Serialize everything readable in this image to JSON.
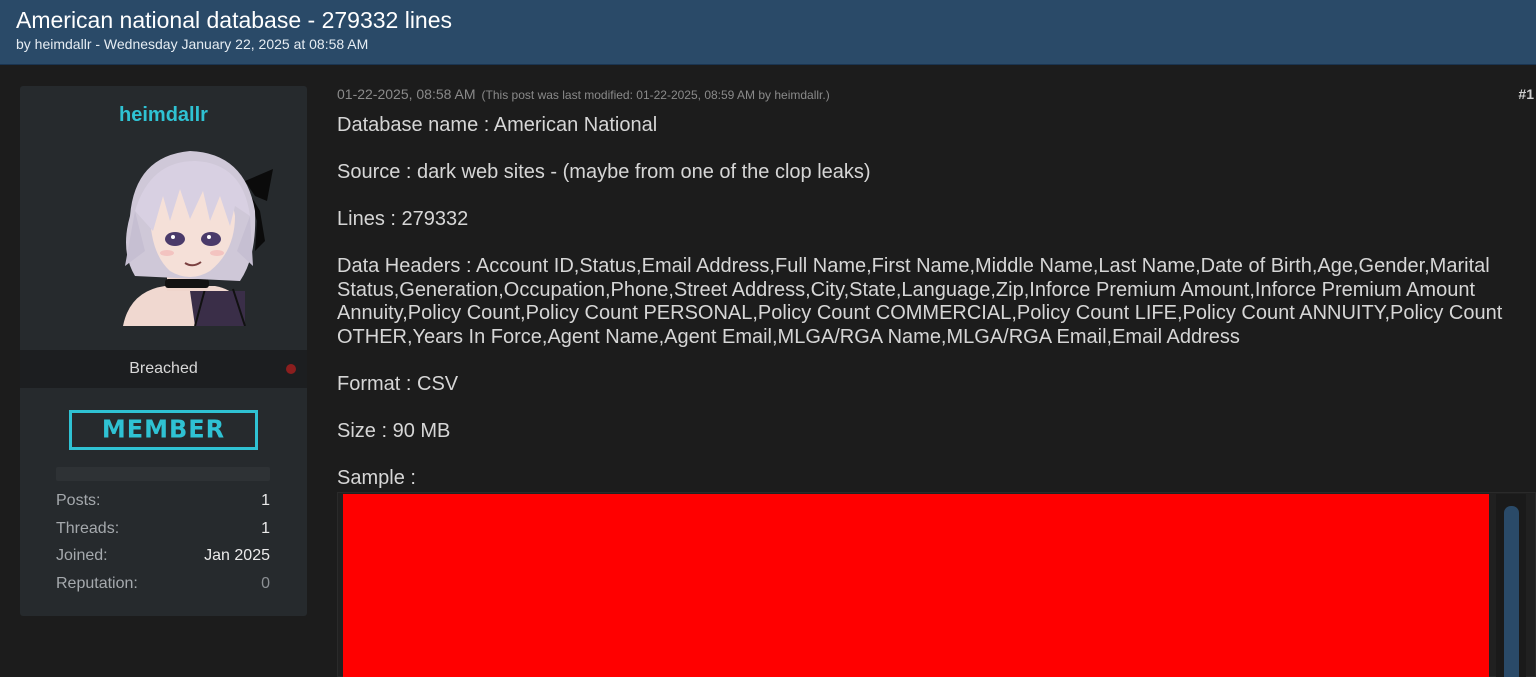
{
  "thread": {
    "title": "American national database - 279332 lines",
    "byline": "by heimdallr - Wednesday January 22, 2025 at 08:58 AM"
  },
  "author": {
    "username": "heimdallr",
    "rank": "Breached",
    "badge": "MEMBER",
    "stats": [
      {
        "label": "Posts:",
        "value": "1"
      },
      {
        "label": "Threads:",
        "value": "1"
      },
      {
        "label": "Joined:",
        "value": "Jan 2025"
      },
      {
        "label": "Reputation:",
        "value": "0"
      }
    ]
  },
  "post": {
    "date": "01-22-2025, 08:58 AM",
    "modified": "(This post was last modified: 01-22-2025, 08:59 AM by heimdallr.)",
    "number": "#1",
    "lines": [
      "Database name : American National",
      "Source : dark web sites - (maybe from one of the clop leaks)",
      "Lines : 279332",
      "Data Headers : Account ID,Status,Email Address,Full Name,First Name,Middle Name,Last Name,Date of Birth,Age,Gender,Marital Status,Generation,Occupation,Phone,Street Address,City,State,Language,Zip,Inforce Premium Amount,Inforce Premium Amount Annuity,Policy Count,Policy Count PERSONAL,Policy Count COMMERCIAL,Policy Count LIFE,Policy Count ANNUITY,Policy Count OTHER,Years In Force,Agent Name,Agent Email,MLGA/RGA Name,MLGA/RGA Email,Email Address",
      "Format : CSV",
      "Size : 90 MB",
      "Sample :"
    ]
  },
  "colors": {
    "header_bg": "#2a4a68",
    "accent": "#2fc2d3",
    "redaction": "#ff0000",
    "status_dot": "#8b1e1e"
  }
}
